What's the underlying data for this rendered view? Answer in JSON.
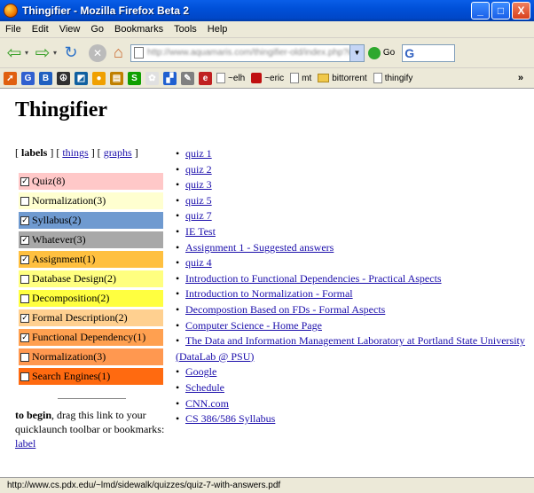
{
  "window": {
    "title": "Thingifier - Mozilla Firefox Beta 2",
    "buttons": [
      "_",
      "□",
      "X"
    ]
  },
  "menu": [
    "File",
    "Edit",
    "View",
    "Go",
    "Bookmarks",
    "Tools",
    "Help"
  ],
  "nav": {
    "url": "http://www.aquamaris.com/thingifier-old/index.php?id",
    "go_label": "Go",
    "search_logo": "G"
  },
  "bookmarks": {
    "icons": [
      {
        "name": "rss-icon",
        "color": "#e06010",
        "glyph": "➚"
      },
      {
        "name": "google-icon",
        "color": "#3060d0",
        "glyph": "G"
      },
      {
        "name": "blogger-icon",
        "color": "#2060c0",
        "glyph": "B"
      },
      {
        "name": "peace-icon",
        "color": "#303030",
        "glyph": "☮"
      },
      {
        "name": "bookmark-icon",
        "color": "#1060a0",
        "glyph": "◩"
      },
      {
        "name": "chat-icon",
        "color": "#f0a000",
        "glyph": "●"
      },
      {
        "name": "box-icon",
        "color": "#c08000",
        "glyph": "▤"
      },
      {
        "name": "skype-icon",
        "color": "#10a000",
        "glyph": "S"
      },
      {
        "name": "flower-icon",
        "color": "#e0e0e0",
        "glyph": "✿"
      },
      {
        "name": "delicious-icon",
        "color": "#2060d0",
        "glyph": "▞"
      },
      {
        "name": "tools-icon",
        "color": "#808080",
        "glyph": "✎"
      },
      {
        "name": "ie-icon",
        "color": "#c02020",
        "glyph": "e"
      }
    ],
    "items": [
      {
        "kind": "pg",
        "label": "~elh"
      },
      {
        "kind": "red",
        "label": "~eric"
      },
      {
        "kind": "pg",
        "label": "mt"
      },
      {
        "kind": "fold",
        "label": "bittorrent"
      },
      {
        "kind": "pg",
        "label": "thingify"
      }
    ],
    "more": "»"
  },
  "page": {
    "heading": "Thingifier",
    "tabs": {
      "labels": "labels",
      "things": "things",
      "graphs": "graphs"
    },
    "labels": [
      {
        "text": "Quiz(8)",
        "checked": true,
        "color": "#ffc8c8"
      },
      {
        "text": "Normalization(3)",
        "checked": false,
        "color": "#ffffd0"
      },
      {
        "text": "Syllabus(2)",
        "checked": true,
        "color": "#6f9ad0"
      },
      {
        "text": "Whatever(3)",
        "checked": true,
        "color": "#a8a8a8"
      },
      {
        "text": "Assignment(1)",
        "checked": true,
        "color": "#ffc040"
      },
      {
        "text": "Database Design(2)",
        "checked": false,
        "color": "#ffff80"
      },
      {
        "text": "Decomposition(2)",
        "checked": false,
        "color": "#ffff40"
      },
      {
        "text": "Formal Description(2)",
        "checked": true,
        "color": "#ffd090"
      },
      {
        "text": "Functional Dependency(1)",
        "checked": true,
        "color": "#ffa050"
      },
      {
        "text": "Normalization(3)",
        "checked": false,
        "color": "#ff9850"
      },
      {
        "text": "Search Engines(1)",
        "checked": false,
        "color": "#ff6a10"
      }
    ],
    "begin": {
      "bold": "to begin",
      "text": ", drag this link to your quicklaunch toolbar or bookmarks: ",
      "link": "label"
    },
    "things": [
      "quiz 1",
      "quiz 2",
      "quiz 3",
      "quiz 5",
      "quiz 7",
      "IE Test",
      "Assignment 1 - Suggested answers",
      "quiz 4",
      "Introduction to Functional Dependencies - Practical Aspects",
      "Introduction to Normalization - Formal",
      "Decompostion Based on FDs - Formal Aspects",
      "Computer Science - Home Page",
      "The Data and Information Management Laboratory at Portland State University (DataLab @ PSU)",
      "Google",
      "Schedule",
      "CNN.com",
      "CS 386/586 Syllabus"
    ]
  },
  "status": "http://www.cs.pdx.edu/~lmd/sidewalk/quizzes/quiz-7-with-answers.pdf"
}
